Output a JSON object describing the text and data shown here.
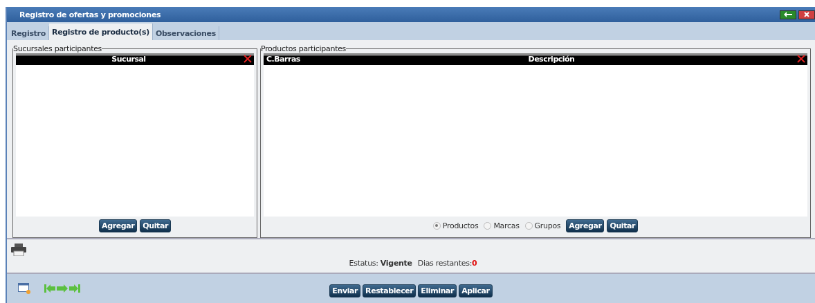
{
  "window": {
    "title": "Registro de ofertas y promociones"
  },
  "tabs": [
    {
      "label": "Registro",
      "selected": false
    },
    {
      "label": "Registro de producto(s)",
      "selected": true
    },
    {
      "label": "Observaciones",
      "selected": false
    }
  ],
  "branches_panel": {
    "legend": "Sucursales participantes",
    "columns": [
      "Sucursal"
    ],
    "buttons": [
      "Agregar",
      "Quitar"
    ]
  },
  "products_panel": {
    "legend": "Productos participantes",
    "columns": [
      "C.Barras",
      "Descripción"
    ],
    "filter": [
      {
        "label": "Productos",
        "selected": true
      },
      {
        "label": "Marcas",
        "selected": false
      },
      {
        "label": "Grupos",
        "selected": false
      }
    ],
    "buttons": [
      "Agregar",
      "Quitar"
    ]
  },
  "status": {
    "label": "Estatus:",
    "value": "Vigente",
    "days_label": "Dias restantes:",
    "days_value": "0"
  },
  "actions": [
    "Enviar",
    "Restablecer",
    "Eliminar",
    "Aplicar"
  ]
}
